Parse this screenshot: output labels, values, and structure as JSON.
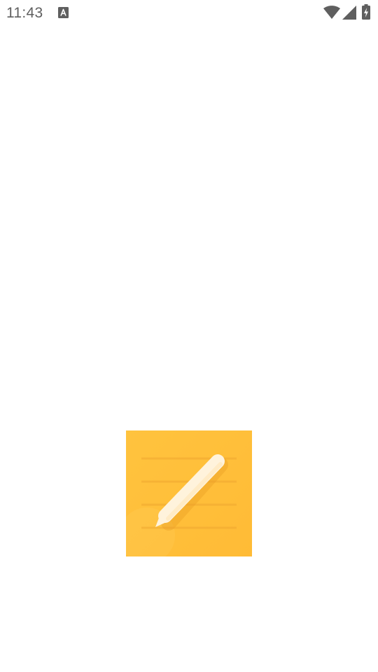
{
  "status_bar": {
    "time": "11:43",
    "notification_icon": "font-a-icon",
    "icons": [
      "wifi-icon",
      "cellular-signal-icon",
      "battery-charging-icon"
    ],
    "icon_color": "#5f5f5f"
  },
  "splash": {
    "icon": "notes-pencil-icon",
    "colors": {
      "pad": "#ffc23c",
      "pad_light": "#ffd060",
      "lines": "#f0a830",
      "pencil": "#fff6e2"
    }
  }
}
